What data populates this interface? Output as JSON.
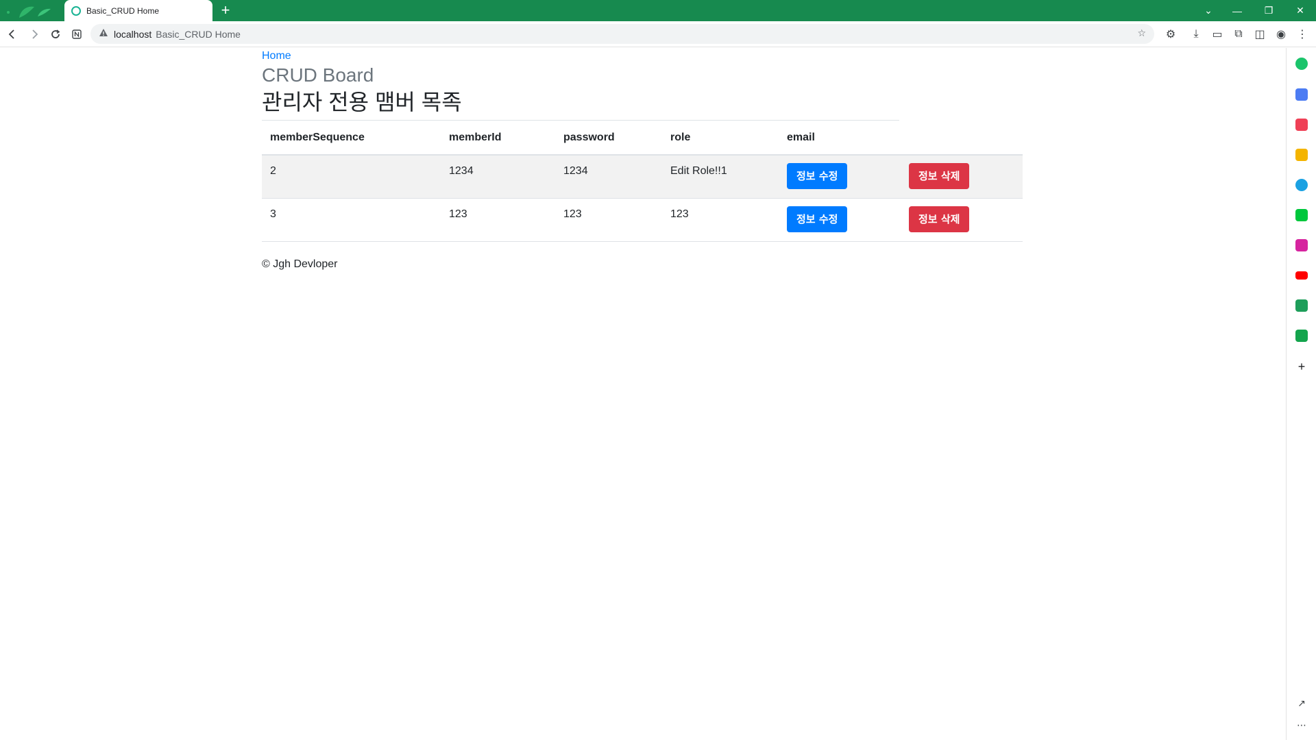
{
  "browser": {
    "tab_title": "Basic_CRUD Home",
    "new_tab_label": "+",
    "address": {
      "host": "localhost",
      "path": "Basic_CRUD Home"
    }
  },
  "page": {
    "home_link": "Home",
    "brand": "CRUD Board",
    "heading": "관리자 전용 맴버 목족",
    "table": {
      "headers": [
        "memberSequence",
        "memberId",
        "password",
        "role",
        "email"
      ],
      "rows": [
        {
          "memberSequence": "2",
          "memberId": "1234",
          "password": "1234",
          "role": "Edit Role!!1",
          "edit_label": "정보 수정",
          "delete_label": "정보 삭제"
        },
        {
          "memberSequence": "3",
          "memberId": "123",
          "password": "123",
          "role": "123",
          "edit_label": "정보 수정",
          "delete_label": "정보 삭제"
        }
      ]
    },
    "footer": "© Jgh Devloper"
  },
  "colors": {
    "browser_accent": "#178a4f",
    "link": "#007bff",
    "primary_button": "#007bff",
    "danger_button": "#dc3545"
  },
  "sidebar_icons": [
    "copilot-icon",
    "calendar-icon",
    "pocket-icon",
    "favorites-icon",
    "edge-icon",
    "webtoon-icon",
    "instagram-icon",
    "youtube-icon",
    "stocks-icon",
    "shopping-icon"
  ]
}
